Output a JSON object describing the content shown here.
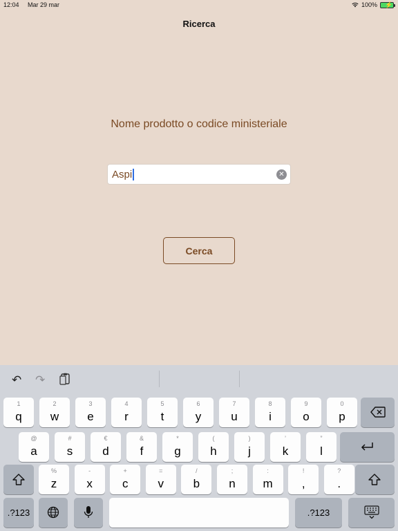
{
  "status_bar": {
    "time": "12:04",
    "date": "Mar 29 mar",
    "battery": "100%"
  },
  "nav": {
    "title": "Ricerca"
  },
  "prompt": "Nome prodotto o codice ministeriale",
  "search": {
    "value": "Aspi"
  },
  "button": {
    "label": "Cerca"
  },
  "keyboard": {
    "row1": [
      {
        "s": "1",
        "p": "q"
      },
      {
        "s": "2",
        "p": "w"
      },
      {
        "s": "3",
        "p": "e"
      },
      {
        "s": "4",
        "p": "r"
      },
      {
        "s": "5",
        "p": "t"
      },
      {
        "s": "6",
        "p": "y"
      },
      {
        "s": "7",
        "p": "u"
      },
      {
        "s": "8",
        "p": "i"
      },
      {
        "s": "9",
        "p": "o"
      },
      {
        "s": "0",
        "p": "p"
      }
    ],
    "row2": [
      {
        "s": "@",
        "p": "a"
      },
      {
        "s": "#",
        "p": "s"
      },
      {
        "s": "€",
        "p": "d"
      },
      {
        "s": "&",
        "p": "f"
      },
      {
        "s": "*",
        "p": "g"
      },
      {
        "s": "(",
        "p": "h"
      },
      {
        "s": ")",
        "p": "j"
      },
      {
        "s": "’",
        "p": "k"
      },
      {
        "s": "”",
        "p": "l"
      }
    ],
    "row3": [
      {
        "s": "%",
        "p": "z"
      },
      {
        "s": "-",
        "p": "x"
      },
      {
        "s": "+",
        "p": "c"
      },
      {
        "s": "=",
        "p": "v"
      },
      {
        "s": "/",
        "p": "b"
      },
      {
        "s": ";",
        "p": "n"
      },
      {
        "s": ":",
        "p": "m"
      },
      {
        "s": "!",
        "p": ","
      },
      {
        "s": "?",
        "p": "."
      }
    ],
    "numbers_label": ".?123"
  }
}
